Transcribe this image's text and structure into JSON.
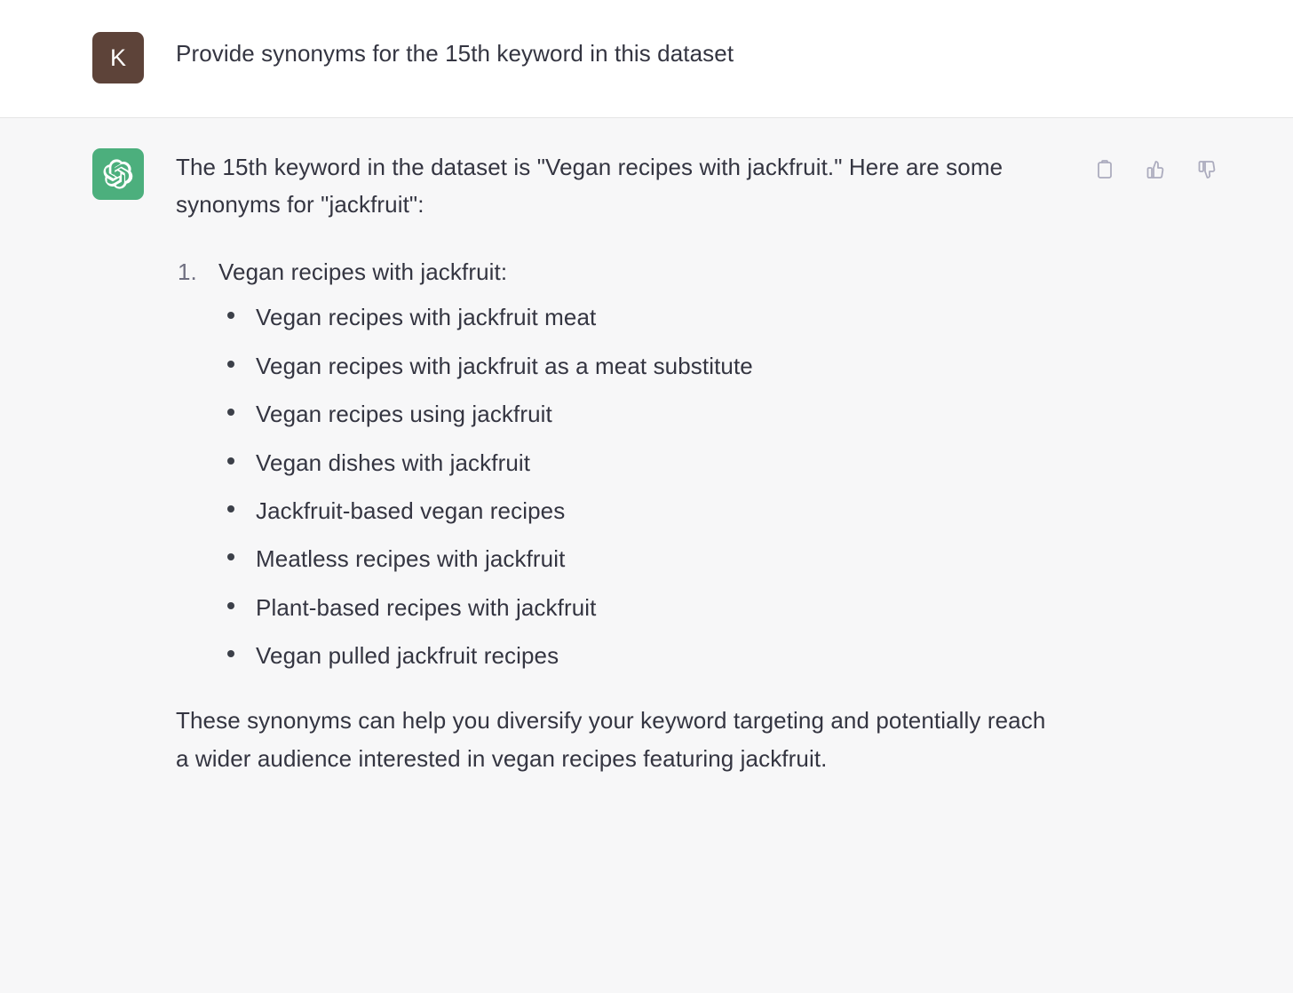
{
  "colors": {
    "user_avatar_bg": "#5d4339",
    "assistant_avatar_bg": "#4caf7d",
    "user_turn_bg": "#ffffff",
    "assistant_turn_bg": "#f7f7f8",
    "text": "#343541",
    "marker": "#6e6e80",
    "icon": "#acacbe",
    "divider": "#e5e5e5"
  },
  "user": {
    "avatar_initial": "K",
    "avatar_icon": "user-avatar",
    "message": "Provide synonyms for the 15th keyword in this dataset"
  },
  "assistant": {
    "avatar_icon": "openai-logo-icon",
    "intro_paragraph": "The 15th keyword in the dataset is \"Vegan recipes with jackfruit.\" Here are some synonyms for \"jackfruit\":",
    "numbered_list": [
      {
        "number": "1.",
        "label": "Vegan recipes with jackfruit:",
        "bullets": [
          "Vegan recipes with jackfruit meat",
          "Vegan recipes with jackfruit as a meat substitute",
          "Vegan recipes using jackfruit",
          "Vegan dishes with jackfruit",
          "Jackfruit-based vegan recipes",
          "Meatless recipes with jackfruit",
          "Plant-based recipes with jackfruit",
          "Vegan pulled jackfruit recipes"
        ]
      }
    ],
    "closing_paragraph": "These synonyms can help you diversify your keyword targeting and potentially reach a wider audience interested in vegan recipes featuring jackfruit."
  },
  "actions": [
    {
      "name": "copy-icon",
      "label": "Copy"
    },
    {
      "name": "thumbs-up-icon",
      "label": "Good response"
    },
    {
      "name": "thumbs-down-icon",
      "label": "Bad response"
    }
  ]
}
